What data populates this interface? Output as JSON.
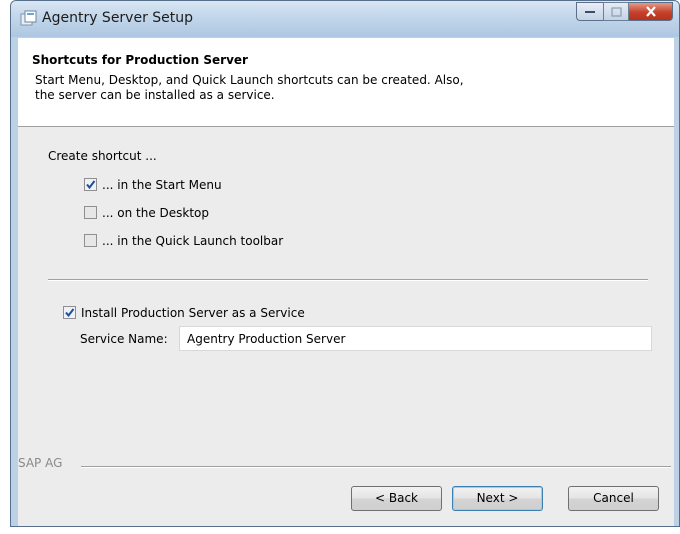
{
  "window": {
    "title": "Agentry Server Setup"
  },
  "header": {
    "title": "Shortcuts for Production Server",
    "description": "Start Menu, Desktop, and Quick Launch shortcuts can be created. Also, the server can be installed as a service."
  },
  "shortcuts": {
    "label": "Create shortcut ...",
    "items": [
      {
        "label": "... in the Start Menu",
        "checked": true
      },
      {
        "label": "... on the Desktop",
        "checked": false
      },
      {
        "label": "... in the Quick Launch toolbar",
        "checked": false
      }
    ]
  },
  "service": {
    "install_label": "Install Production Server as a Service",
    "install_checked": true,
    "name_label": "Service Name:",
    "name_value": "Agentry Production Server"
  },
  "footer": {
    "vendor": "SAP AG",
    "back_label": "< Back",
    "next_label": "Next >",
    "cancel_label": "Cancel"
  },
  "colors": {
    "title_bar": "#c2d6ea",
    "close_button": "#c5412b",
    "check_mark": "#1f4e9c"
  }
}
